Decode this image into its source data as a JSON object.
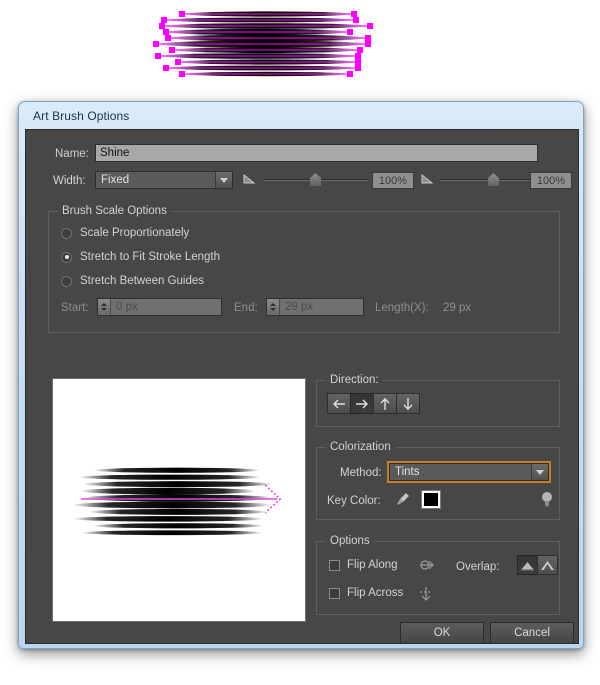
{
  "window": {
    "title": "Art Brush Options"
  },
  "form": {
    "name_label": "Name:",
    "name_value": "Shine",
    "width_label": "Width:",
    "width_value": "Fixed",
    "width_percent_1": "100%",
    "width_percent_2": "100%"
  },
  "brush_scale": {
    "legend": "Brush Scale Options",
    "options": [
      {
        "label": "Scale Proportionately",
        "selected": false
      },
      {
        "label": "Stretch to Fit Stroke Length",
        "selected": true
      },
      {
        "label": "Stretch Between Guides",
        "selected": false
      }
    ],
    "start_label": "Start:",
    "start_value": "0 px",
    "end_label": "End:",
    "end_value": "29 px",
    "length_label": "Length(X):",
    "length_value": "29 px"
  },
  "direction": {
    "legend": "Direction:",
    "buttons": [
      {
        "icon": "arrow-left-icon",
        "glyph": "←",
        "selected": false
      },
      {
        "icon": "arrow-right-icon",
        "glyph": "→",
        "selected": true
      },
      {
        "icon": "arrow-up-icon",
        "glyph": "↑",
        "selected": false
      },
      {
        "icon": "arrow-down-icon",
        "glyph": "↓",
        "selected": false
      }
    ]
  },
  "colorization": {
    "legend": "Colorization",
    "method_label": "Method:",
    "method_value": "Tints",
    "key_color_label": "Key Color:",
    "key_color_swatch": "#000000",
    "eyedropper_icon": "eyedropper-icon",
    "tip_icon": "lightbulb-icon"
  },
  "options": {
    "legend": "Options",
    "flip_along_label": "Flip Along",
    "flip_along_checked": false,
    "flip_across_label": "Flip Across",
    "flip_across_checked": false,
    "overlap_label": "Overlap:",
    "overlap_buttons": [
      {
        "icon": "overlap-flatten-icon",
        "selected": true
      },
      {
        "icon": "overlap-allow-icon",
        "selected": false
      }
    ]
  },
  "footer": {
    "ok_label": "OK",
    "cancel_label": "Cancel"
  },
  "colors": {
    "selection_magenta": "#FF00FF",
    "dialog_body": "#474747",
    "accent_focus": "#C87D24"
  }
}
